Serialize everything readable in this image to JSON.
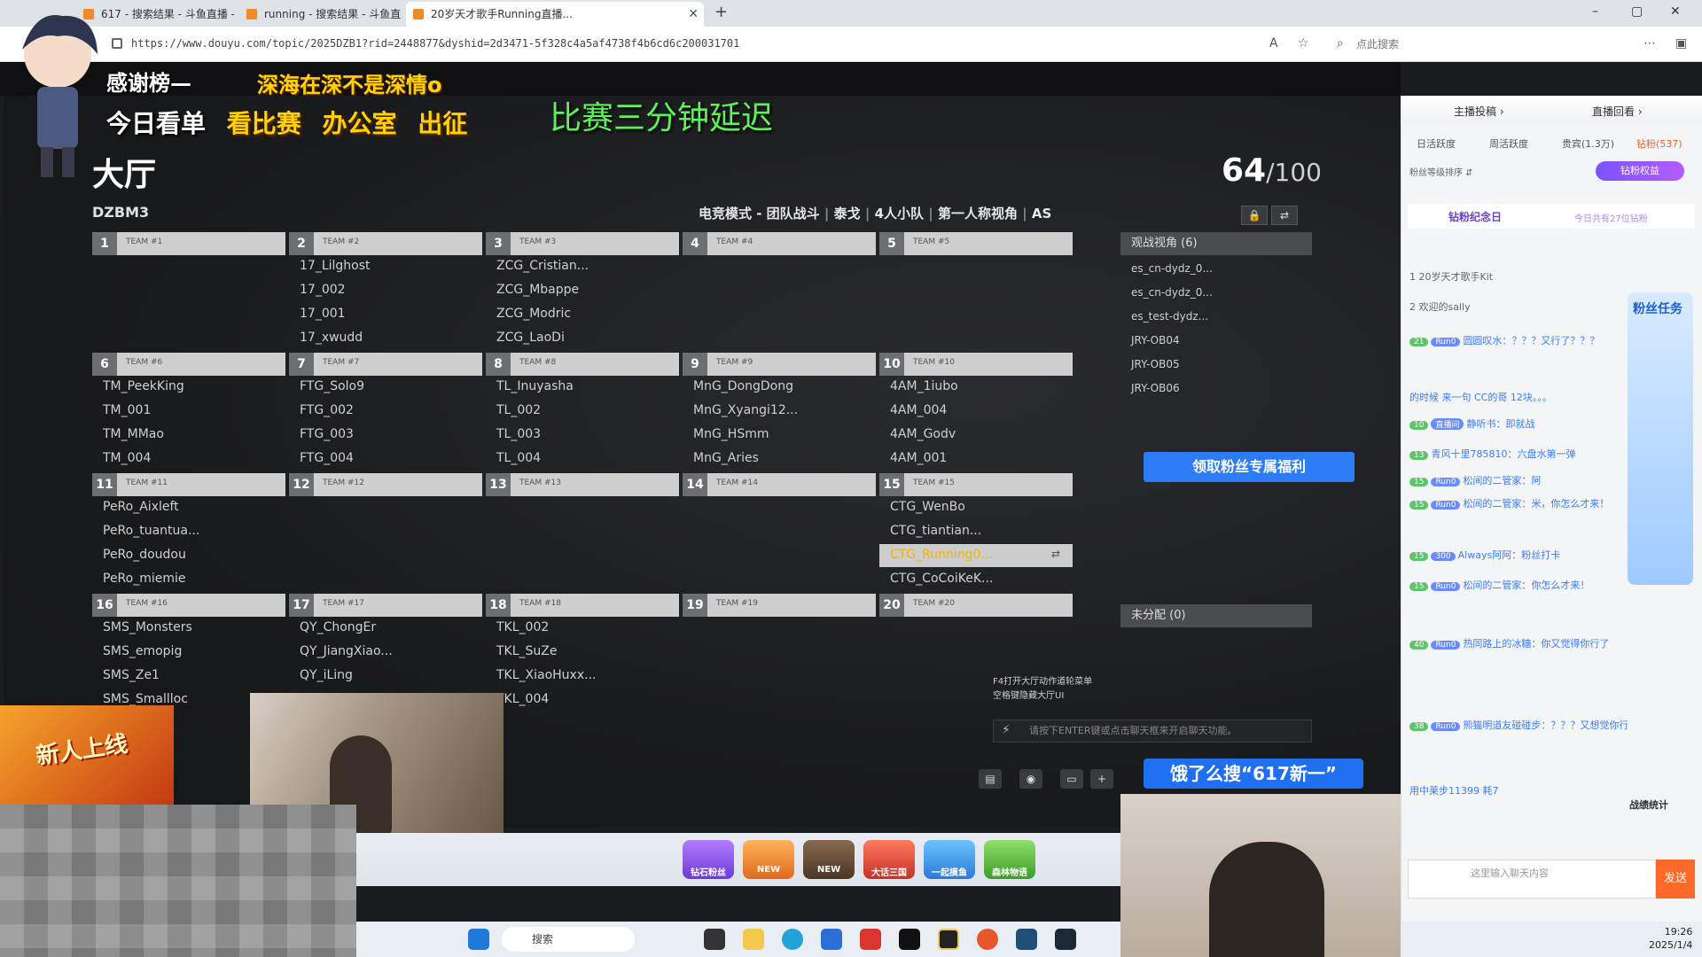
{
  "browser": {
    "tabs": [
      {
        "label": "617 - 搜索结果 - 斗鱼直播 - 游戏..."
      },
      {
        "label": "running - 搜索结果 - 斗鱼直播 - ..."
      },
      {
        "label": "20岁天才歌手Running直播..."
      }
    ],
    "new_tab": "+",
    "url": "https://www.douyu.com/topic/2025DZB1?rid=2448877&dyshid=2d3471-5f328c4a5af4738f4b6cd6c200031701",
    "search_placeholder": "点此搜索",
    "win_min": "–",
    "win_max": "▢",
    "win_close": "✕"
  },
  "overlay": {
    "thanks_label": "感谢榜—",
    "thanks_names": "深海在深不是深情o",
    "menu": [
      "今日看单",
      "看比赛",
      "办公室",
      "出征"
    ],
    "delay_note": "比赛三分钟延迟"
  },
  "lobby": {
    "title": "大厅",
    "count": "64",
    "capacity": "/100",
    "match_code": "DZBM3",
    "mode": "电竞模式 - 团队战斗",
    "map": "泰戈",
    "squad": "4人小队",
    "view": "第一人称视角",
    "region": "AS",
    "lock_icon": "🔒",
    "swap_icon": "⇄",
    "teams": [
      {
        "num": "1",
        "name": "TEAM #1",
        "players": []
      },
      {
        "num": "2",
        "name": "TEAM #2",
        "players": [
          "17_Lilghost",
          "17_002",
          "17_001",
          "17_xwudd"
        ]
      },
      {
        "num": "3",
        "name": "TEAM #3",
        "players": [
          "ZCG_Cristian...",
          "ZCG_Mbappe",
          "ZCG_Modric",
          "ZCG_LaoDi"
        ]
      },
      {
        "num": "4",
        "name": "TEAM #4",
        "players": []
      },
      {
        "num": "5",
        "name": "TEAM #5",
        "players": []
      },
      {
        "num": "6",
        "name": "TEAM #6",
        "players": [
          "TM_PeekKing",
          "TM_001",
          "TM_MMao",
          "TM_004"
        ]
      },
      {
        "num": "7",
        "name": "TEAM #7",
        "players": [
          "FTG_Solo9",
          "FTG_002",
          "FTG_003",
          "FTG_004"
        ]
      },
      {
        "num": "8",
        "name": "TEAM #8",
        "players": [
          "TL_Inuyasha",
          "TL_002",
          "TL_003",
          "TL_004"
        ]
      },
      {
        "num": "9",
        "name": "TEAM #9",
        "players": [
          "MnG_DongDong",
          "MnG_Xyangi12...",
          "MnG_HSmm",
          "MnG_Aries"
        ]
      },
      {
        "num": "10",
        "name": "TEAM #10",
        "players": [
          "4AM_1iubo",
          "4AM_004",
          "4AM_Godv",
          "4AM_001"
        ]
      },
      {
        "num": "11",
        "name": "TEAM #11",
        "players": [
          "PeRo_Aixleft",
          "PeRo_tuantua...",
          "PeRo_doudou",
          "PeRo_miemie"
        ]
      },
      {
        "num": "12",
        "name": "TEAM #12",
        "players": []
      },
      {
        "num": "13",
        "name": "TEAM #13",
        "players": []
      },
      {
        "num": "14",
        "name": "TEAM #14",
        "players": []
      },
      {
        "num": "15",
        "name": "TEAM #15",
        "players": [
          "CTG_WenBo",
          "CTG_tiantian...",
          "CTG_Running0...",
          "CTG_CoCoiKeK..."
        ]
      },
      {
        "num": "16",
        "name": "TEAM #16",
        "players": [
          "SMS_Monsters",
          "SMS_emopig",
          "SMS_Ze1",
          "SMS_Smallloc"
        ]
      },
      {
        "num": "17",
        "name": "TEAM #17",
        "players": [
          "QY_ChongEr",
          "QY_JiangXiao...",
          "QY_iLing",
          ""
        ]
      },
      {
        "num": "18",
        "name": "TEAM #18",
        "players": [
          "TKL_002",
          "TKL_SuZe",
          "TKL_XiaoHuxx...",
          "TKL_004"
        ]
      },
      {
        "num": "19",
        "name": "TEAM #19",
        "players": []
      },
      {
        "num": "20",
        "name": "TEAM #20",
        "players": []
      }
    ],
    "spectators_header": "观战视角 (6)",
    "spectators": [
      "es_cn-dydz_0...",
      "es_cn-dydz_0...",
      "es_test-dydz...",
      "JRY-OB04",
      "JRY-OB05",
      "JRY-OB06"
    ],
    "unassigned": "未分配 (0)",
    "chat_hint_1": "F4打开大厅动作道轮菜单",
    "chat_hint_2": "空格键隐藏大厅UI",
    "chat_input_hint": "请按下ENTER键或点击聊天框来开启聊天功能。",
    "bolt_icon": "⚡"
  },
  "buttons": {
    "fan_benefit": "领取粉丝专属福利",
    "search_promo": "饿了么搜“617新一”"
  },
  "promo_card": "新人上线",
  "gifts": [
    "钻石粉丝",
    "NEW",
    "NEW",
    "大话三国",
    "一起摸鱼",
    "森林物语"
  ],
  "taskbar": {
    "search": "搜索",
    "time": "19:26",
    "date": "2025/1/4"
  },
  "sidebar": {
    "top_links": [
      "主播投稿 ›",
      "直播回看 ›"
    ],
    "tabs": [
      "日活跃度",
      "周活跃度",
      "贵宾(1.3万)",
      "钻粉(537)"
    ],
    "rank_line": "粉丝等级排序 ⇵",
    "fan_perk": "钻粉权益",
    "diamond_title": "钻粉纪念日",
    "diamond_sub": "今日共有27位钻粉",
    "rank_rows": [
      "1  20岁天才歌手Kit",
      "2  欢迎的sally"
    ],
    "chat": [
      {
        "lvl": "21",
        "tag": "Run0",
        "nick": "圆圆叹水：",
        "text": "？？？又行了？？？"
      },
      {
        "lvl": "",
        "tag": "",
        "nick": "",
        "text": "的时候 来一句  CC的哥 12块。。。"
      },
      {
        "lvl": "10",
        "tag": "直播间",
        "nick": "静听书：",
        "text": "即就战"
      },
      {
        "lvl": "13",
        "tag": "",
        "nick": "青风十里785810：",
        "text": "六盘水第一弹"
      },
      {
        "lvl": "15",
        "tag": "Run0",
        "nick": "松间的二管家：",
        "text": "阿"
      },
      {
        "lvl": "15",
        "tag": "Run0",
        "nick": "松间的二管家：",
        "text": "米，你怎么才来！"
      },
      {
        "lvl": "15",
        "tag": "300",
        "nick": "Always阿阿：",
        "text": "粉丝打卡"
      },
      {
        "lvl": "15",
        "tag": "Run0",
        "nick": "松间的二管家：",
        "text": "你怎么才来！"
      },
      {
        "lvl": "40",
        "tag": "Run0",
        "nick": "热同路上的冰糖",
        "text": "：你又觉得你行了"
      },
      {
        "lvl": "38",
        "tag": "Run0",
        "nick": "熊猫明道友碰碰步",
        "text": "：？？？又想觉你行了？"
      },
      {
        "lvl": "",
        "tag": "",
        "nick": "用中莱步11399 耗",
        "text": "7"
      }
    ],
    "fanquest": "粉丝任务",
    "battle_label": "战绩统计",
    "input_placeholder": "这里输入聊天内容",
    "send": "发送"
  }
}
